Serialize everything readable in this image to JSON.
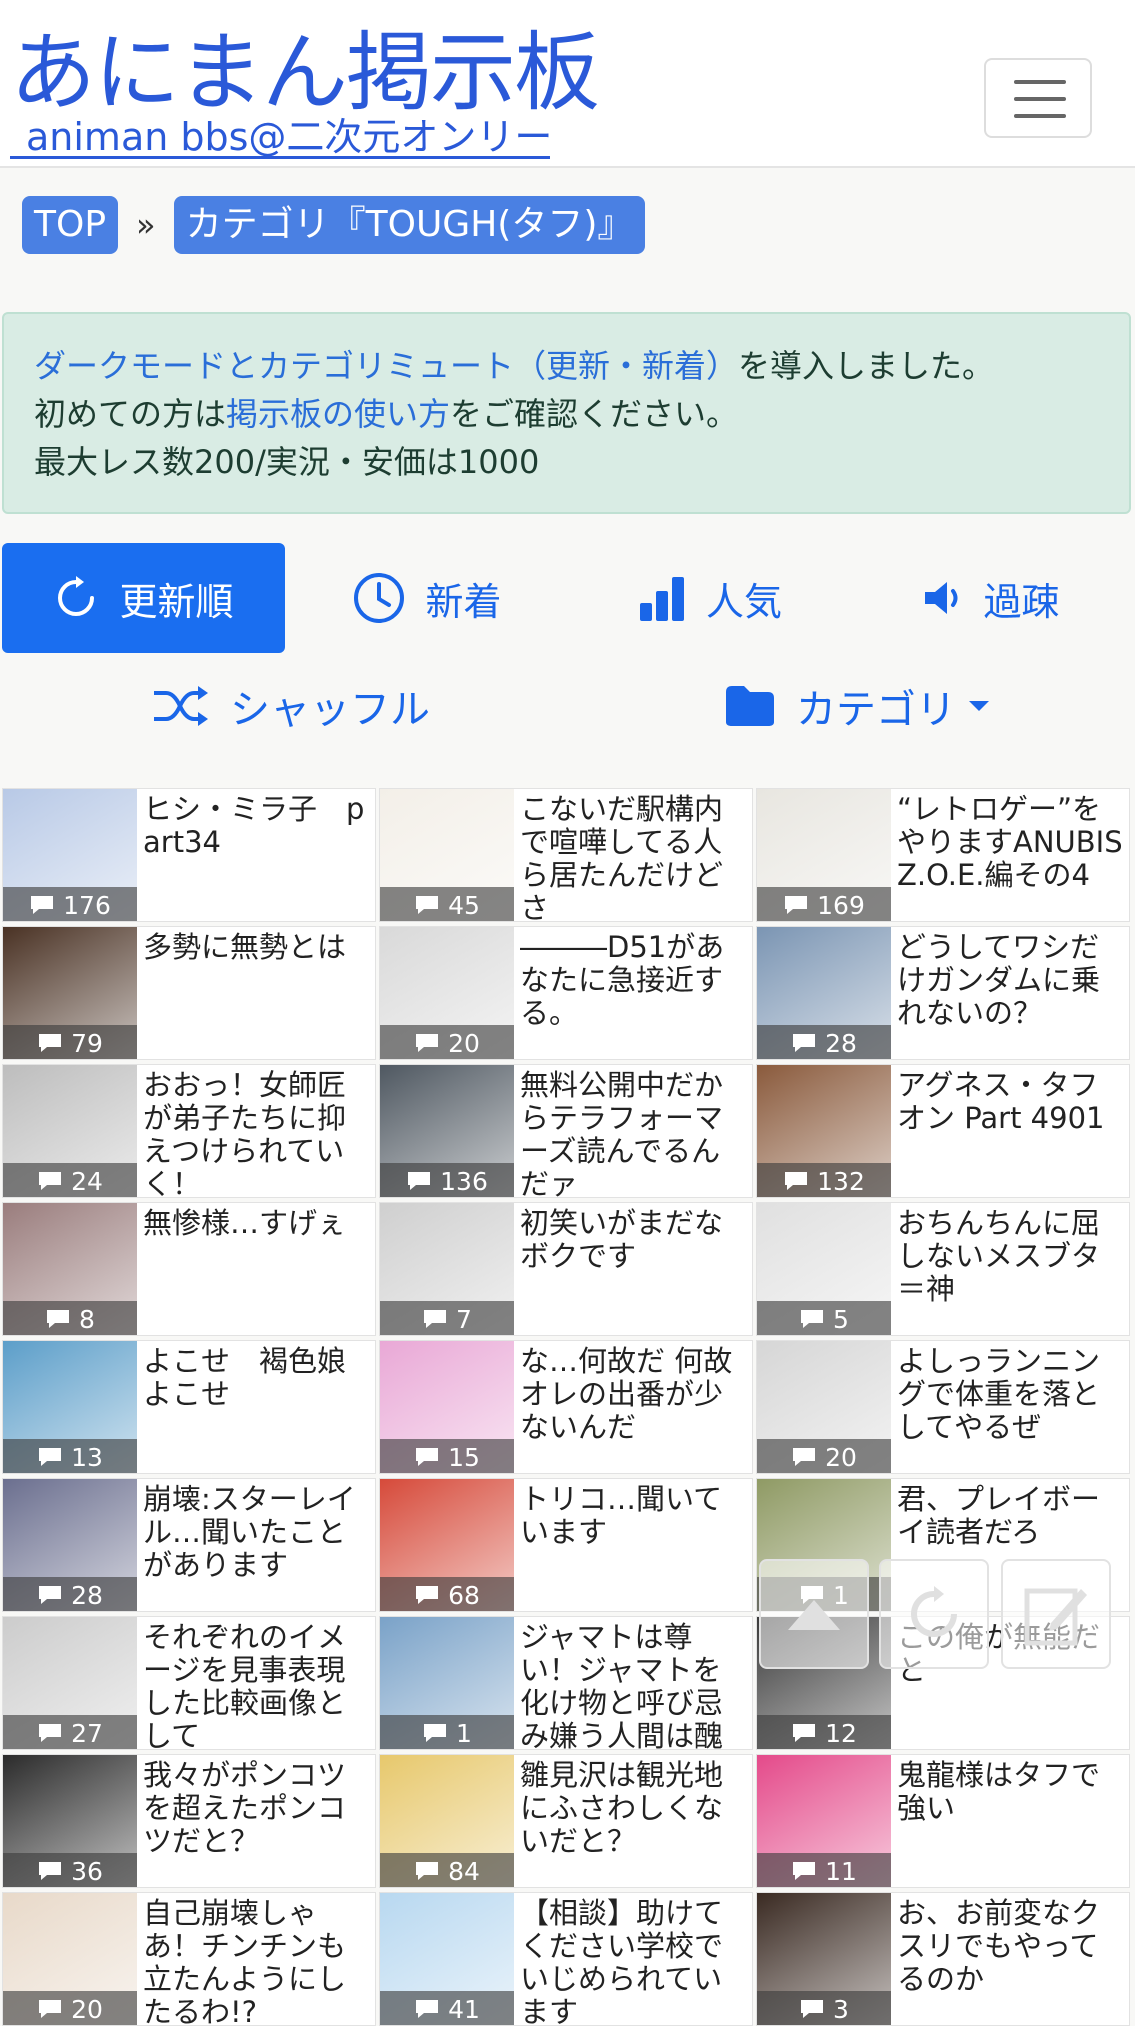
{
  "header": {
    "logo_main": "あにまん掲示板",
    "logo_sub": "animan bbs@二次元オンリー",
    "menu_icon": "hamburger-menu-icon"
  },
  "breadcrumb": {
    "home": "TOP",
    "separator": "»",
    "current": "カテゴリ『TOUGH(タフ)』"
  },
  "notice": {
    "line1_link": "ダークモードとカテゴリミュート（更新・新着）",
    "line1_rest": "を導入しました。",
    "line2_pre": "初めての方は",
    "line2_link": "掲示板の使い方",
    "line2_post": "をご確認ください。",
    "line3": "最大レス数200/実況・安価は1000"
  },
  "tabs": [
    {
      "label": "更新順",
      "icon": "refresh-icon",
      "active": true
    },
    {
      "label": "新着",
      "icon": "clock-icon",
      "active": false
    },
    {
      "label": "人気",
      "icon": "bar-chart-icon",
      "active": false
    },
    {
      "label": "過疎",
      "icon": "speaker-icon",
      "active": false
    }
  ],
  "tools": {
    "shuffle": "シャッフル",
    "category": "カテゴリ"
  },
  "threads": [
    {
      "title": "ヒシ・ミラ子　part34",
      "count": "176",
      "color": "#b8c9e6"
    },
    {
      "title": "こないだ駅構内で喧嘩してる人ら居たんだけどさ",
      "count": "45",
      "color": "#f3efe8"
    },
    {
      "title": "“レトロゲー”をやりますANUBIS Z.O.E.編その4",
      "count": "169",
      "color": "#e8e6e0"
    },
    {
      "title": "多勢に無勢とは",
      "count": "79",
      "color": "#4a3224"
    },
    {
      "title": "―――D51があなたに急接近する。",
      "count": "20",
      "color": "#d9d9d9"
    },
    {
      "title": "どうしてワシだけガンダムに乗れないの？",
      "count": "28",
      "color": "#7b95b3"
    },
    {
      "title": "おおっ！女師匠が弟子たちに抑えつけられていく！",
      "count": "24",
      "color": "#bdbdbd"
    },
    {
      "title": "無料公開中だからテラフォーマーズ読んでるんだァ",
      "count": "136",
      "color": "#4f5861"
    },
    {
      "title": "アグネス・タフオン Part 4901",
      "count": "132",
      "color": "#8a5a3c"
    },
    {
      "title": "無惨様…すげぇ",
      "count": "8",
      "color": "#9a7d7d"
    },
    {
      "title": "初笑いがまだなボクです",
      "count": "7",
      "color": "#cfcfcf"
    },
    {
      "title": "おちんちんに屈しないメスブタ＝神",
      "count": "5",
      "color": "#e0e0e0"
    },
    {
      "title": "よこせ　褐色娘よこせ",
      "count": "13",
      "color": "#5c9ec9"
    },
    {
      "title": "な…何故だ 何故オレの出番が少ないんだ",
      "count": "15",
      "color": "#e9a8d6"
    },
    {
      "title": "よしっランニングで体重を落としてやるぜ",
      "count": "20",
      "color": "#d6d6d6"
    },
    {
      "title": "崩壊:スターレイル…聞いたことがあります",
      "count": "28",
      "color": "#6b6f8f"
    },
    {
      "title": "トリコ…聞いています",
      "count": "68",
      "color": "#d64a3a"
    },
    {
      "title": "君、プレイボーイ読者だろ",
      "count": "1",
      "color": "#8f9a64"
    },
    {
      "title": "それぞれのイメージを見事表現した比較画像として",
      "count": "27",
      "color": "#cccccc"
    },
    {
      "title": "ジャマトは尊い！ジャマトを化け物と呼び忌み嫌う人間は醜",
      "count": "1",
      "color": "#7aa2c8"
    },
    {
      "title": "この俺が無能だと",
      "count": "12",
      "color": "#3a3a3a"
    },
    {
      "title": "我々がポンコツを超えたポンコツだと？",
      "count": "36",
      "color": "#2b2b2b"
    },
    {
      "title": "雛見沢は観光地にふさわしくないだと？",
      "count": "84",
      "color": "#e7c86c"
    },
    {
      "title": "鬼龍様はタフで強い",
      "count": "11",
      "color": "#e44a8a"
    },
    {
      "title": "自己崩壊しゃあ！チンチンも立たんようにしたるわ!?",
      "count": "20",
      "color": "#e8d9c9"
    },
    {
      "title": "【相談】助けてください学校でいじめられています",
      "count": "41",
      "color": "#b8d8f0"
    },
    {
      "title": "お、お前変なクスリでもやってるのか",
      "count": "3",
      "color": "#3a2a22"
    }
  ],
  "floating": {
    "up_icon": "scroll-top-icon",
    "reload_icon": "reload-icon",
    "edit_icon": "edit-icon"
  }
}
